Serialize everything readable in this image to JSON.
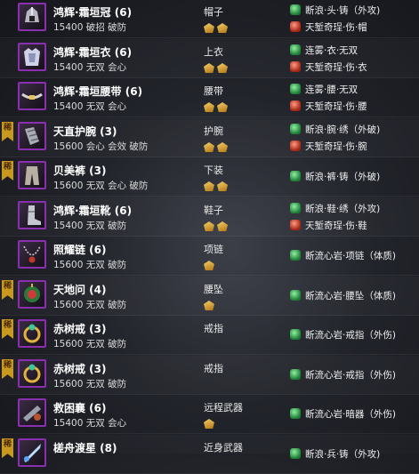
{
  "items": [
    {
      "name": "鸿辉·霜垣冠 (6)",
      "stats": "15400 破招 破防",
      "slot": "帽子",
      "stones": 2,
      "tag": false,
      "icon": "helmet-icon",
      "enchants": [
        {
          "type": "green",
          "text": "断浪·头·铸（外攻)"
        },
        {
          "type": "red",
          "text": "天堑奇珵·伤·帽"
        }
      ]
    },
    {
      "name": "鸿辉·霜垣衣 (6)",
      "stats": "15400 无双 会心",
      "slot": "上衣",
      "stones": 2,
      "tag": false,
      "icon": "armor-icon",
      "enchants": [
        {
          "type": "green",
          "text": "连雾·衣·无双"
        },
        {
          "type": "red",
          "text": "天堑奇珵·伤·衣"
        }
      ]
    },
    {
      "name": "鸿辉·霜垣腰带 (6)",
      "stats": "15400 无双 会心",
      "slot": "腰带",
      "stones": 2,
      "tag": false,
      "icon": "belt-icon",
      "enchants": [
        {
          "type": "green",
          "text": "连雾·腰·无双"
        },
        {
          "type": "red",
          "text": "天堑奇珵·伤·腰"
        }
      ]
    },
    {
      "name": "天直护腕 (3)",
      "stats": "15600 会心 会效 破防",
      "slot": "护腕",
      "stones": 2,
      "tag": true,
      "icon": "bracer-icon",
      "enchants": [
        {
          "type": "green",
          "text": "断浪·腕·绣（外破)"
        },
        {
          "type": "red",
          "text": "天堑奇珵·伤·腕"
        }
      ]
    },
    {
      "name": "贝美裤 (3)",
      "stats": "15600 无双 会心 破防",
      "slot": "下装",
      "stones": 2,
      "tag": true,
      "icon": "pants-icon",
      "enchants": [
        {
          "type": "green",
          "text": "断浪·裤·铸（外破)"
        }
      ]
    },
    {
      "name": "鸿辉·霜垣靴 (6)",
      "stats": "15400 无双 破防",
      "slot": "鞋子",
      "stones": 2,
      "tag": false,
      "icon": "boots-icon",
      "enchants": [
        {
          "type": "green",
          "text": "断浪·鞋·绣（外攻)"
        },
        {
          "type": "red",
          "text": "天堑奇珵·伤·鞋"
        }
      ]
    },
    {
      "name": "照耀链 (6)",
      "stats": "15600 无双 破防",
      "slot": "项链",
      "stones": 1,
      "tag": false,
      "icon": "necklace-icon",
      "enchants": [
        {
          "type": "green",
          "text": "断流心岩·项链（体质)"
        }
      ]
    },
    {
      "name": "天地问 (4)",
      "stats": "15600 无双 破防",
      "slot": "腰坠",
      "stones": 1,
      "tag": true,
      "icon": "pendant-icon",
      "enchants": [
        {
          "type": "green",
          "text": "断流心岩·腰坠（体质)"
        }
      ]
    },
    {
      "name": "赤树戒 (3)",
      "stats": "15600 无双 破防",
      "slot": "戒指",
      "stones": 0,
      "tag": true,
      "icon": "ring-icon",
      "enchants": [
        {
          "type": "green",
          "text": "断流心岩·戒指（外伤)"
        }
      ]
    },
    {
      "name": "赤树戒 (3)",
      "stats": "15600 无双 破防",
      "slot": "戒指",
      "stones": 0,
      "tag": true,
      "icon": "ring-icon",
      "enchants": [
        {
          "type": "green",
          "text": "断流心岩·戒指（外伤)"
        }
      ]
    },
    {
      "name": "救困襄 (6)",
      "stats": "15400 无双 会心",
      "slot": "远程武器",
      "stones": 1,
      "tag": false,
      "icon": "ranged-weapon-icon",
      "enchants": [
        {
          "type": "green",
          "text": "断流心岩·暗器（外伤)"
        }
      ]
    },
    {
      "name": "槎舟渡星 (8)",
      "stats": "",
      "slot": "近身武器",
      "stones": 0,
      "tag": true,
      "icon": "melee-weapon-icon",
      "enchants": [
        {
          "type": "green",
          "text": "断浪·兵·铸（外攻)"
        }
      ]
    }
  ],
  "tag_label": "稀",
  "colors": {
    "icon_border": "#8a2fb0",
    "tag": "#c9981e",
    "stone": "#e2a93a",
    "green_gem": "#2f9b4a",
    "red_gem": "#c0392b"
  }
}
